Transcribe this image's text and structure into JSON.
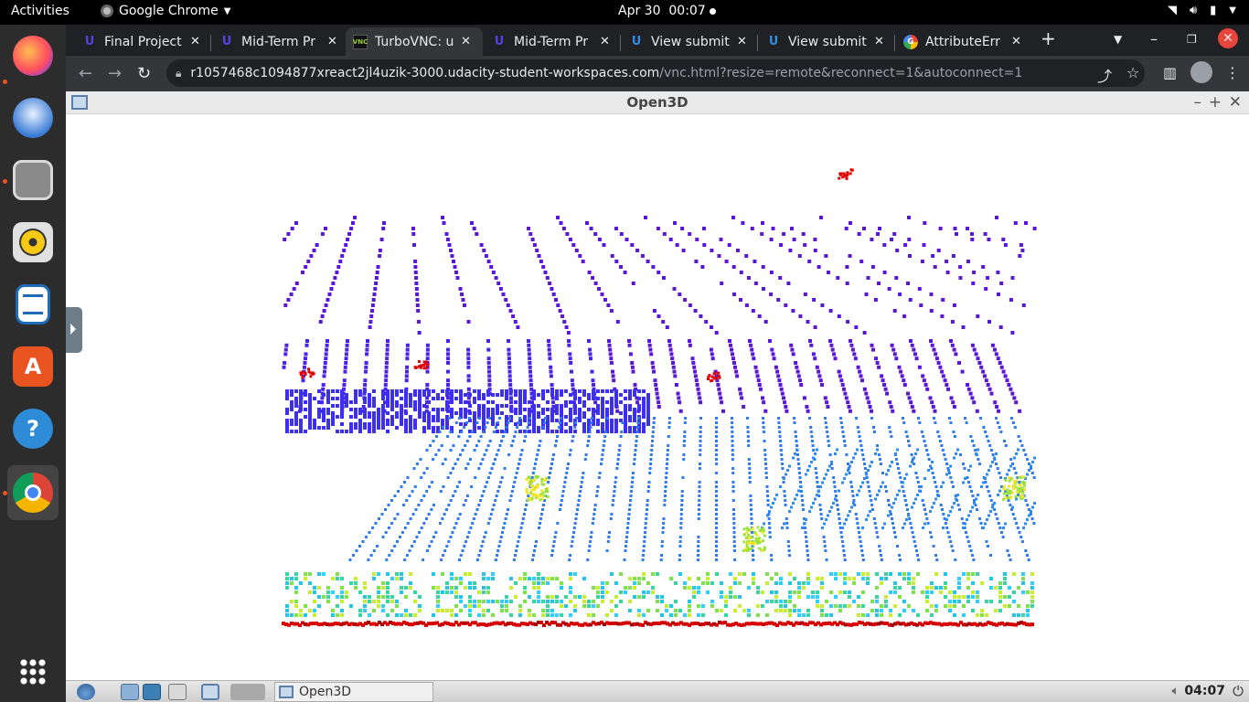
{
  "topbar": {
    "activities": "Activities",
    "app_name": "Google Chrome",
    "date": "Apr 30",
    "time": "00:07"
  },
  "dock": {
    "items": [
      {
        "name": "firefox",
        "running": true
      },
      {
        "name": "thunderbird",
        "running": false
      },
      {
        "name": "files",
        "running": true
      },
      {
        "name": "rhythmbox",
        "running": false
      },
      {
        "name": "libreoffice-writer",
        "running": false
      },
      {
        "name": "ubuntu-software",
        "running": false
      },
      {
        "name": "help",
        "running": false
      },
      {
        "name": "google-chrome",
        "running": true,
        "active": true
      }
    ]
  },
  "tabs": [
    {
      "label": "Final Project",
      "favicon": "udacity",
      "active": false
    },
    {
      "label": "Mid-Term Pr",
      "favicon": "udacity",
      "active": false
    },
    {
      "label": "TurboVNC: u",
      "favicon": "vnc",
      "active": true
    },
    {
      "label": "Mid-Term Pr",
      "favicon": "udacity",
      "active": false
    },
    {
      "label": "View submit",
      "favicon": "udacity",
      "active": false
    },
    {
      "label": "View submit",
      "favicon": "udacity",
      "active": false
    },
    {
      "label": "AttributeErr",
      "favicon": "google",
      "active": false
    }
  ],
  "address": {
    "host": "r1057468c1094877xreact2jl4uzik-3000.udacity-student-workspaces.com",
    "path": "/vnc.html?resize=remote&reconnect=1&autoconnect=1"
  },
  "vnc_window": {
    "title": "Open3D"
  },
  "vnc_taskbar": {
    "task_label": "Open3D",
    "time": "04:07"
  },
  "colors": {
    "ubuntu_accent": "#e95420",
    "chrome_dark": "#202124",
    "chrome_toolbar": "#35363a",
    "pointcloud_far": "#5b16d8",
    "pointcloud_near": "#2f7bf0",
    "ground_red": "#d70000"
  }
}
